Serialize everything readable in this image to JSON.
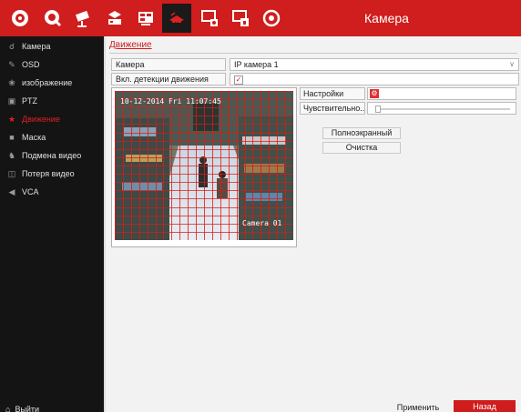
{
  "title": "Камера",
  "top_icons": [
    "camera-settings-icon",
    "record-icon",
    "camera-network-icon",
    "network-icon",
    "hdd-icon",
    "event-icon",
    "system-icon",
    "account-icon",
    "power-icon"
  ],
  "sidebar": {
    "items": [
      {
        "label": "Камера",
        "icon": "camera-icon"
      },
      {
        "label": "OSD",
        "icon": "osd-icon"
      },
      {
        "label": "изображение",
        "icon": "image-icon"
      },
      {
        "label": "PTZ",
        "icon": "ptz-icon"
      },
      {
        "label": "Движение",
        "icon": "motion-icon",
        "active": true
      },
      {
        "label": "Маска",
        "icon": "mask-icon"
      },
      {
        "label": "Подмена видео",
        "icon": "tamper-icon"
      },
      {
        "label": "Потеря видео",
        "icon": "video-loss-icon"
      },
      {
        "label": "VCA",
        "icon": "vca-icon"
      }
    ],
    "exit_label": "Выйти"
  },
  "main": {
    "heading": "Движение",
    "camera_label": "Камера",
    "camera_value": "IP камера 1",
    "enable_label": "Вкл. детекции движения",
    "enable_checked": true,
    "settings_label": "Настройки",
    "sensitivity_label": "Чувствительно...",
    "sensitivity_value": 0.0,
    "fullscreen_label": "Полноэкранный",
    "clear_label": "Очистка",
    "video_osd_time": "10-12-2014 Fri 11:07:45",
    "video_osd_name": "Camera 01"
  },
  "footer": {
    "apply_label": "Применить",
    "back_label": "Назад"
  },
  "colors": {
    "accent": "#d01d1d",
    "sidebar": "#141414",
    "grid": "#e01818"
  }
}
